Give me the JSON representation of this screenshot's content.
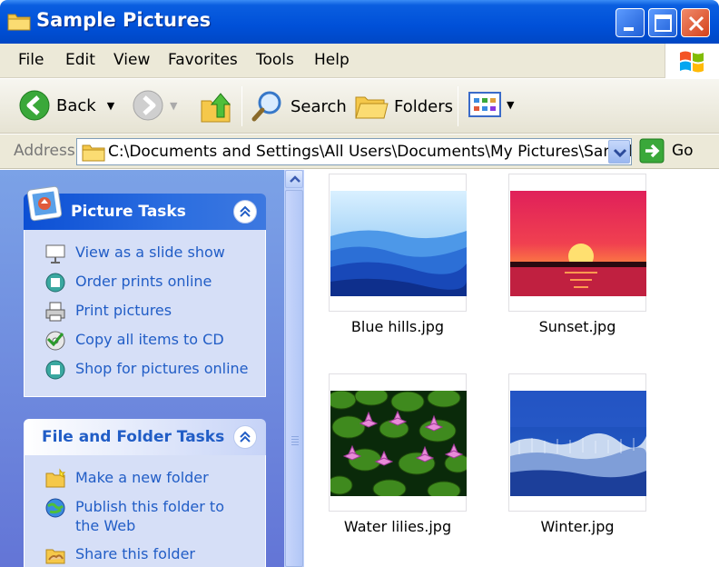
{
  "window": {
    "title": "Sample Pictures",
    "controls": [
      "minimize",
      "maximize",
      "close"
    ]
  },
  "menu": [
    "File",
    "Edit",
    "View",
    "Favorites",
    "Tools",
    "Help"
  ],
  "toolbar": {
    "back_label": "Back",
    "search_label": "Search",
    "folders_label": "Folders"
  },
  "address": {
    "label": "Address",
    "value": "C:\\Documents and Settings\\All Users\\Documents\\My Pictures\\Sample Pic",
    "go_label": "Go"
  },
  "picture_tasks": {
    "title": "Picture Tasks",
    "items": [
      {
        "label": "View as a slide show",
        "icon": "slideshow-icon"
      },
      {
        "label": "Order prints online",
        "icon": "order-prints-icon"
      },
      {
        "label": "Print pictures",
        "icon": "printer-icon"
      },
      {
        "label": "Copy all items to CD",
        "icon": "copy-cd-icon"
      },
      {
        "label": "Shop for pictures online",
        "icon": "shop-online-icon"
      }
    ]
  },
  "file_folder_tasks": {
    "title": "File and Folder Tasks",
    "items": [
      {
        "label": "Make a new folder",
        "icon": "new-folder-icon"
      },
      {
        "label": "Publish this folder to the Web",
        "icon": "publish-web-icon"
      },
      {
        "label": "Share this folder",
        "icon": "share-folder-icon"
      }
    ]
  },
  "files": [
    {
      "name": "Blue hills.jpg"
    },
    {
      "name": "Sunset.jpg"
    },
    {
      "name": "Water lilies.jpg"
    },
    {
      "name": "Winter.jpg"
    }
  ],
  "colors": {
    "titlebar": "#0050d8",
    "task_link": "#215dc6",
    "pane_bg": "#7ba2e7"
  }
}
